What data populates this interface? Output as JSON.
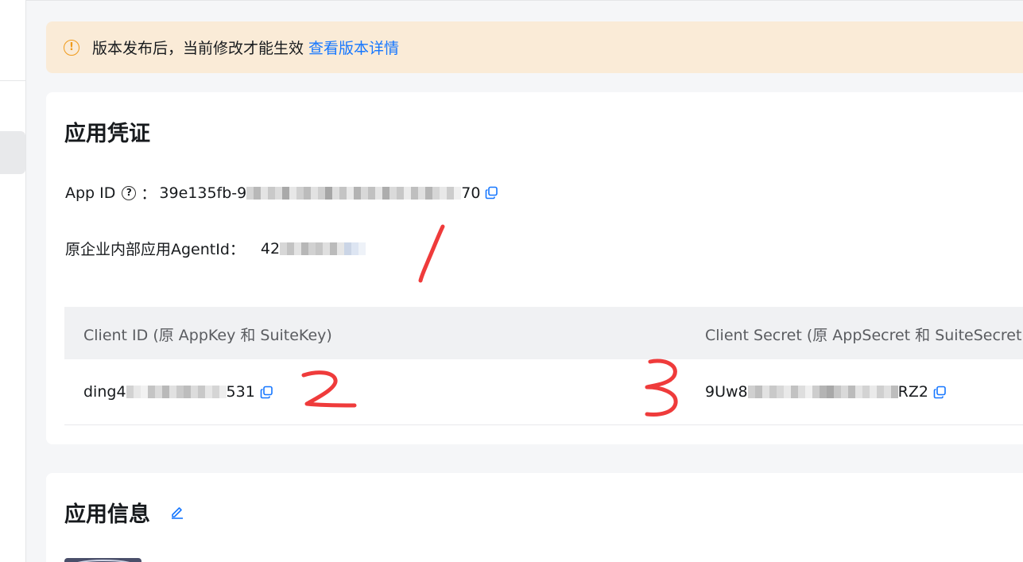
{
  "notice": {
    "icon": "info-circle-icon",
    "text": "版本发布后，当前修改才能生效",
    "link": "查看版本详情"
  },
  "credentials": {
    "title": "应用凭证",
    "app_id": {
      "label": "App ID",
      "colon": "：",
      "value_prefix": "39e135fb-9",
      "value_suffix": "70"
    },
    "agent_id": {
      "label": "原企业内部应用AgentId：",
      "value_prefix": "42"
    },
    "table": {
      "headers": [
        "Client ID (原 AppKey 和 SuiteKey)",
        "Client Secret (原 AppSecret 和 SuiteSecret)"
      ],
      "client_id": {
        "prefix": "ding4",
        "suffix": "531"
      },
      "client_secret": {
        "prefix": "9Uw8",
        "suffix": "RZ2"
      }
    }
  },
  "info": {
    "title": "应用信息"
  },
  "colors": {
    "accent": "#1677ff",
    "notice_bg": "#faebd7",
    "notice_icon": "#f09a1a",
    "annotation": "#ef3b3b"
  }
}
